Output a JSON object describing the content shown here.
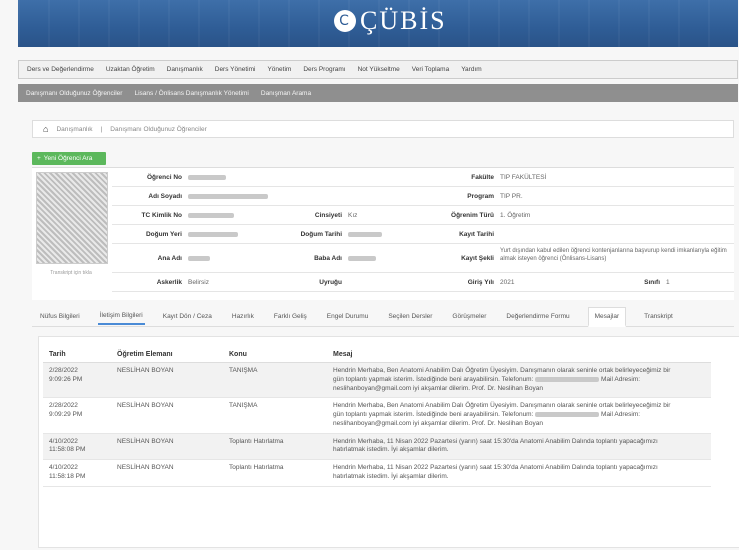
{
  "app": {
    "logo_text": "ÇÜBİS",
    "logo_mark": "C"
  },
  "top_nav": [
    "Ders ve Değerlendirme",
    "Uzaktan Öğretim",
    "Danışmanlık",
    "Ders Yönetimi",
    "Yönetim",
    "Ders Programı",
    "Not Yükseltme",
    "Veri Toplama",
    "Yardım"
  ],
  "sub_nav": [
    "Danışmanı Olduğunuz Öğrenciler",
    "Lisans / Önlisans Danışmanlık Yönetimi",
    "Danışman Arama"
  ],
  "breadcrumb": [
    "Danışmanlık",
    "Danışmanı Olduğunuz Öğrenciler"
  ],
  "new_student_button": "Yeni Öğrenci Ara",
  "photo_link": "Transkript için tıkla",
  "student": {
    "ogrenci_no_label": "Öğrenci No",
    "ad_soyad_label": "Adı Soyadı",
    "tc_label": "TC Kimlik No",
    "cinsiyet_label": "Cinsiyeti",
    "cinsiyet": "Kız",
    "dogum_yeri_label": "Doğum Yeri",
    "dogum_tarihi_label": "Doğum Tarihi",
    "ana_adi_label": "Ana Adı",
    "baba_adi_label": "Baba Adı",
    "askerlik_label": "Askerlik",
    "askerlik": "Belirsiz",
    "uyrugu_label": "Uyruğu",
    "fakulte_label": "Fakülte",
    "fakulte": "TIP FAKÜLTESİ",
    "program_label": "Program",
    "program": "TIP PR.",
    "ogrenim_turu_label": "Öğrenim Türü",
    "ogrenim_turu": "1. Öğretim",
    "kayit_tarihi_label": "Kayıt Tarihi",
    "kayit_sekli_label": "Kayıt Şekli",
    "kayit_sekli": "Yurt dışından kabul edilen öğrenci kontenjanlarına başvurup kendi imkanlarıyla eğitim almak isteyen öğrenci (Önlisans-Lisans)",
    "giris_yili_label": "Giriş Yılı",
    "giris_yili": "2021",
    "sinif_label": "Sınıfı",
    "sinif": "1"
  },
  "tabs": [
    "Nüfus Bilgileri",
    "İletişim Bilgileri",
    "Kayıt Dön / Ceza",
    "Hazırlık",
    "Farklı Geliş",
    "Engel Durumu",
    "Seçilen Dersler",
    "Görüşmeler",
    "Değerlendirme Formu",
    "Mesajlar",
    "Transkript"
  ],
  "active_tab": "Mesajlar",
  "messages": {
    "headers": [
      "Tarih",
      "Öğretim Elemanı",
      "Konu",
      "Mesaj"
    ],
    "rows": [
      {
        "date": "2/28/2022",
        "time": "9:09:26 PM",
        "staff": "NESLİHAN BOYAN",
        "subject": "TANIŞMA",
        "msg1": "Hendrin Merhaba, Ben Anatomi Anabilim Dalı Öğretim Üyesiyim. Danışmanın olarak seninle ortak belirleyeceğimiz bir",
        "msg2": "gün toplantı yapmak isterim. İstediğinde beni arayabilirsin. Telefonum:",
        "msg2b": "Mail Adresim:",
        "msg3": "neslihanboyan@gmail.com iyi akşamlar dilerim. Prof. Dr. Neslihan Boyan"
      },
      {
        "date": "2/28/2022",
        "time": "9:09:29 PM",
        "staff": "NESLİHAN BOYAN",
        "subject": "TANIŞMA",
        "msg1": "Hendrin Merhaba, Ben Anatomi Anabilim Dalı Öğretim Üyesiyim. Danışmanın olarak seninle ortak belirleyeceğimiz bir",
        "msg2": "gün toplantı yapmak isterim. İstediğinde beni arayabilirsin. Telefonum:",
        "msg2b": "Mail Adresim:",
        "msg3": "neslihanboyan@gmail.com iyi akşamlar dilerim. Prof. Dr. Neslihan Boyan"
      },
      {
        "date": "4/10/2022",
        "time": "11:58:08 PM",
        "staff": "NESLİHAN BOYAN",
        "subject": "Toplantı Hatırlatma",
        "msg1": "Hendrin Merhaba, 11 Nisan 2022 Pazartesi (yarın) saat 15:30'da Anatomi Anabilim Dalında toplantı yapacağımızı",
        "msg2": "hatırlatmak istedim. İyi akşamlar dilerim.",
        "msg2b": "",
        "msg3": ""
      },
      {
        "date": "4/10/2022",
        "time": "11:58:18 PM",
        "staff": "NESLİHAN BOYAN",
        "subject": "Toplantı Hatırlatma",
        "msg1": "Hendrin Merhaba, 11 Nisan 2022 Pazartesi (yarın) saat 15:30'da Anatomi Anabilim Dalında toplantı yapacağımızı",
        "msg2": "hatırlatmak istedim. İyi akşamlar dilerim.",
        "msg2b": "",
        "msg3": ""
      }
    ]
  }
}
